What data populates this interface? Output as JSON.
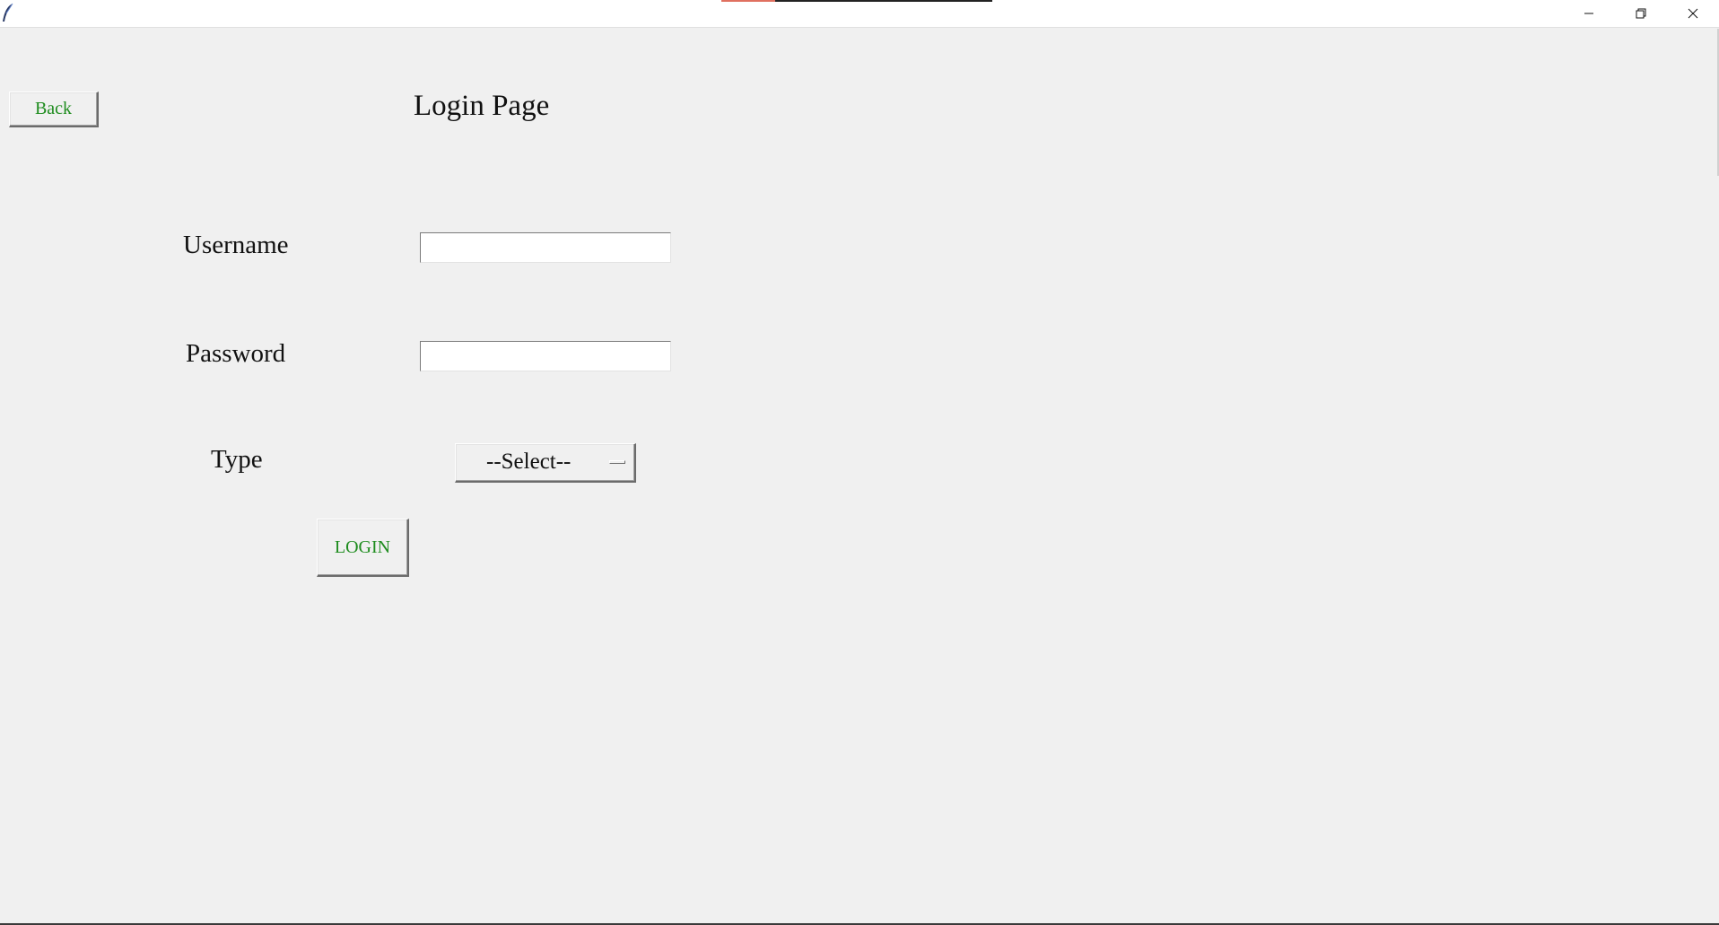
{
  "window": {
    "controls": {
      "minimize_icon": "minimize-icon",
      "maximize_icon": "restore-icon",
      "close_icon": "close-icon"
    }
  },
  "page": {
    "back_label": "Back",
    "title": "Login Page",
    "username_label": "Username",
    "password_label": "Password",
    "type_label": "Type",
    "username_value": "",
    "password_value": "",
    "type_selected": "--Select--",
    "login_label": "LOGIN"
  },
  "colors": {
    "background": "#f0f0f0",
    "button_text": "#1e8c1e"
  }
}
